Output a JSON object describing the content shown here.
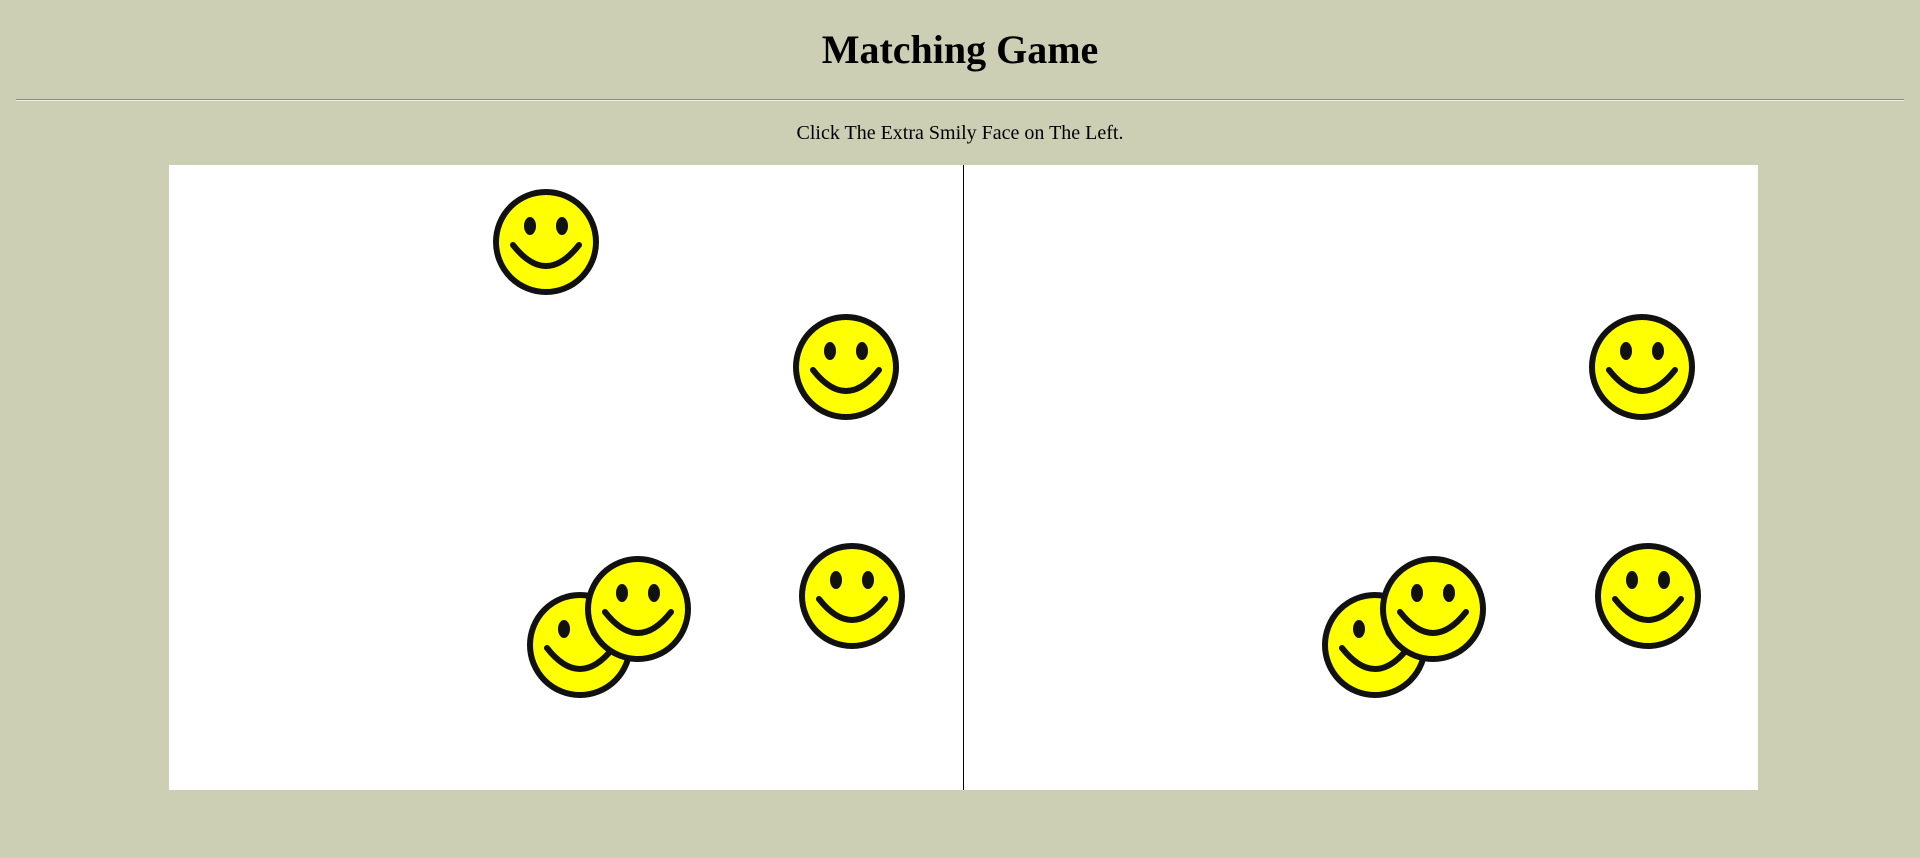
{
  "game": {
    "title": "Matching Game",
    "instructions": "Click The Extra Smily Face on The Left."
  },
  "colors": {
    "background": "#cccfb4",
    "board": "#ffffff",
    "face_fill": "#ffff00",
    "face_outline": "#111111"
  },
  "icons": {
    "face": "smiley-face-icon"
  },
  "boards": {
    "left": {
      "face_count": 5
    },
    "right": {
      "face_count": 4
    }
  }
}
